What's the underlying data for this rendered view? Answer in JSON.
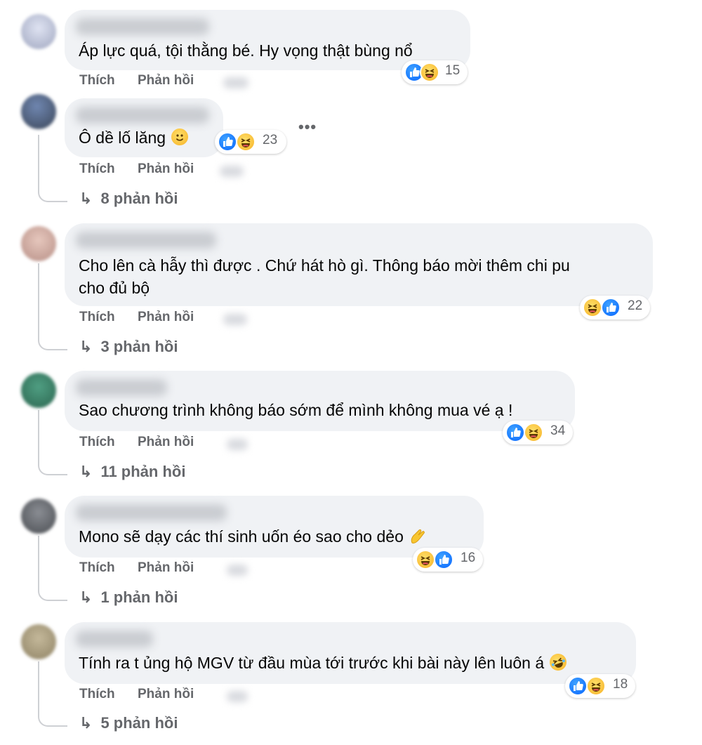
{
  "labels": {
    "like": "Thích",
    "reply": "Phản hồi",
    "reply_arrow": "↳"
  },
  "more_label": "•••",
  "comments": [
    {
      "text": "Áp lực quá, tội thằng bé. Hy vọng thật bùng nổ",
      "reaction_count": "15",
      "replies": ""
    },
    {
      "text": "Ô dề lố lăng",
      "reaction_count": "23",
      "replies": "8 phản hồi"
    },
    {
      "text_line1": "Cho lên cà hẫy thì được . Chứ hát hò gì. Thông báo mời thêm chi pu",
      "text_line2": "cho đủ bộ",
      "reaction_count": "22",
      "replies": "3 phản hồi"
    },
    {
      "text": "Sao chương trình không báo sớm để mình không mua vé ạ !",
      "reaction_count": "34",
      "replies": "11 phản hồi"
    },
    {
      "text": "Mono sẽ dạy các thí sinh uốn éo sao cho dẻo",
      "reaction_count": "16",
      "replies": "1 phản hồi"
    },
    {
      "text": "Tính ra t ủng hộ MGV từ đầu mùa tới trước khi bài này lên luôn á",
      "reaction_count": "18",
      "replies": "5 phản hồi"
    }
  ],
  "colors": {
    "bubble": "#f0f2f5",
    "secondary_text": "#65676b",
    "like_blue": "#0866ff",
    "haha_yellow": "#f7b125"
  },
  "icons": [
    "like-reaction-icon",
    "haha-reaction-icon",
    "smile-emoji-icon",
    "pinching-hand-emoji-icon",
    "rolling-laughing-emoji-icon",
    "reply-arrow-icon",
    "more-options-icon"
  ]
}
